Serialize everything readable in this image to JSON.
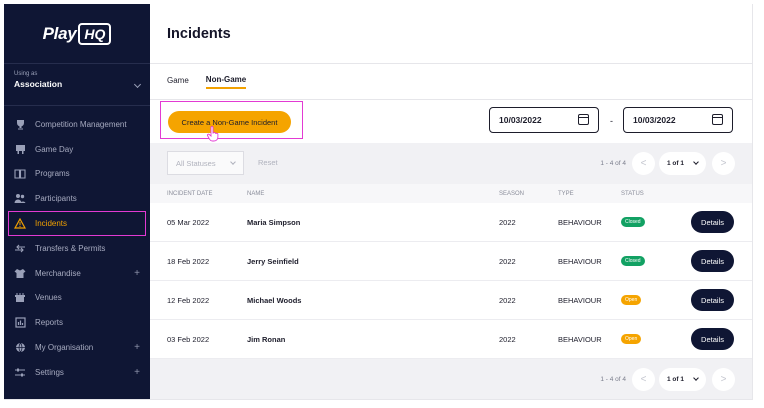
{
  "brand": {
    "logo_text": "Play",
    "logo_badge": "HQ"
  },
  "org": {
    "caption": "Using as",
    "name": "Association"
  },
  "sidebar": {
    "items": [
      {
        "label": "Competition Management",
        "icon": "trophy-icon"
      },
      {
        "label": "Game Day",
        "icon": "scoreboard-icon"
      },
      {
        "label": "Programs",
        "icon": "book-icon"
      },
      {
        "label": "Participants",
        "icon": "people-icon"
      },
      {
        "label": "Incidents",
        "icon": "warning-icon",
        "active": true
      },
      {
        "label": "Transfers & Permits",
        "icon": "transfer-icon"
      },
      {
        "label": "Merchandise",
        "icon": "shirt-icon",
        "expand": "+"
      },
      {
        "label": "Venues",
        "icon": "stadium-icon"
      },
      {
        "label": "Reports",
        "icon": "chart-icon"
      },
      {
        "label": "My Organisation",
        "icon": "globe-icon",
        "expand": "+"
      },
      {
        "label": "Settings",
        "icon": "sliders-icon",
        "expand": "+"
      }
    ]
  },
  "header": {
    "title": "Incidents"
  },
  "tabs": [
    {
      "label": "Game",
      "active": false
    },
    {
      "label": "Non-Game",
      "active": true
    }
  ],
  "toolbar": {
    "create_label": "Create a Non-Game Incident",
    "date_from": "10/03/2022",
    "date_to": "10/03/2022",
    "date_separator": "-"
  },
  "filters": {
    "status_placeholder": "All Statuses",
    "reset_label": "Reset"
  },
  "pagination": {
    "range": "1 - 4 of 4",
    "page_label": "1 of 1",
    "prev": "<",
    "next": ">"
  },
  "table": {
    "columns": [
      "INCIDENT DATE",
      "NAME",
      "SEASON",
      "TYPE",
      "STATUS"
    ],
    "rows": [
      {
        "date": "05 Mar 2022",
        "name": "Maria Simpson",
        "season": "2022",
        "type": "BEHAVIOUR",
        "status": "Closed",
        "action": "Details"
      },
      {
        "date": "18 Feb 2022",
        "name": "Jerry Seinfield",
        "season": "2022",
        "type": "BEHAVIOUR",
        "status": "Closed",
        "action": "Details"
      },
      {
        "date": "12 Feb 2022",
        "name": "Michael Woods",
        "season": "2022",
        "type": "BEHAVIOUR",
        "status": "Open",
        "action": "Details"
      },
      {
        "date": "03 Feb 2022",
        "name": "Jim Ronan",
        "season": "2022",
        "type": "BEHAVIOUR",
        "status": "Open",
        "action": "Details"
      }
    ]
  },
  "colors": {
    "accent": "#f5a400",
    "navy": "#0f1634",
    "highlight": "#e23ad3",
    "closed": "#12a163"
  }
}
